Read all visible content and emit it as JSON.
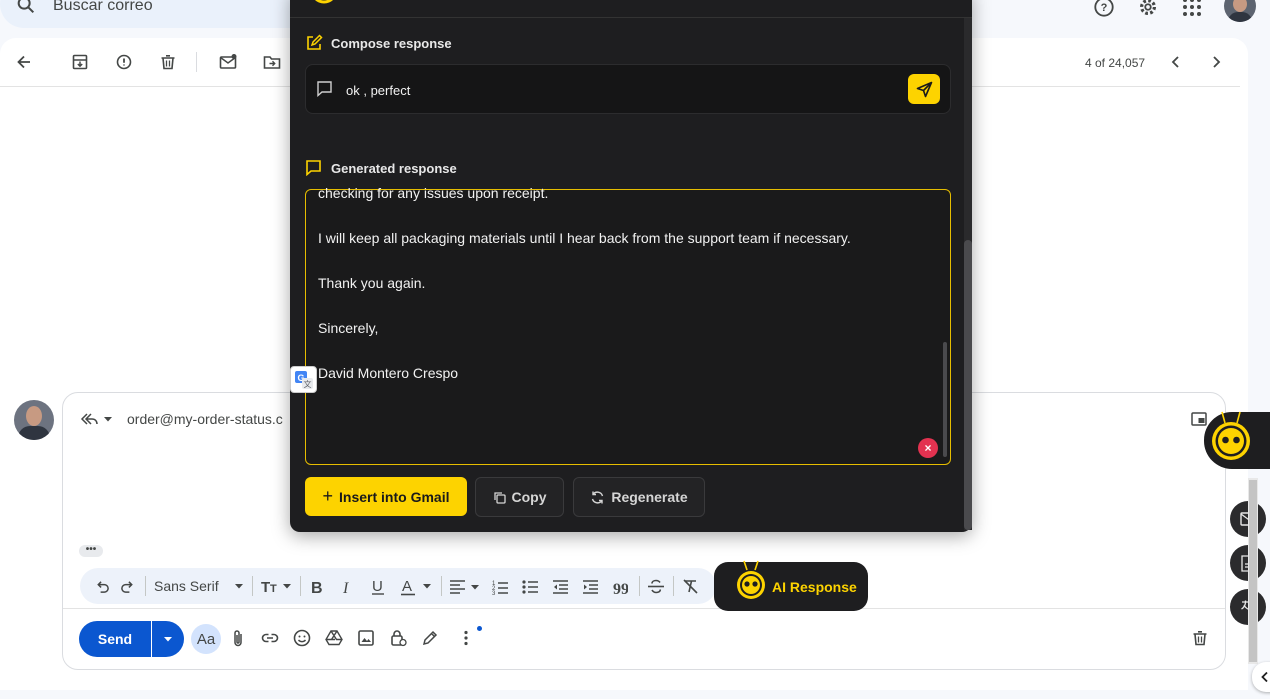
{
  "search": {
    "placeholder": "Buscar correo"
  },
  "toolbar": {
    "page_count": "4 of 24,057"
  },
  "reply": {
    "to": "order@my-order-status.c",
    "font_name": "Sans Serif",
    "send_label": "Send",
    "aa_label": "Aa"
  },
  "ai_panel": {
    "compose_title": "Compose response",
    "compose_text": "ok , perfect",
    "generated_title": "Generated response",
    "generated_lines": [
      "checking for any issues upon receipt.",
      "I will keep all packaging materials until I hear back from the support team if necessary.",
      "Thank you again.",
      "Sincerely,",
      "David Montero Crespo"
    ],
    "insert_label": "Insert into Gmail",
    "copy_label": "Copy",
    "regenerate_label": "Regenerate"
  },
  "ai_response_label": "AI Response",
  "colors": {
    "accent": "#fdd300",
    "panel": "#1e1e20",
    "send": "#0b57d0"
  }
}
